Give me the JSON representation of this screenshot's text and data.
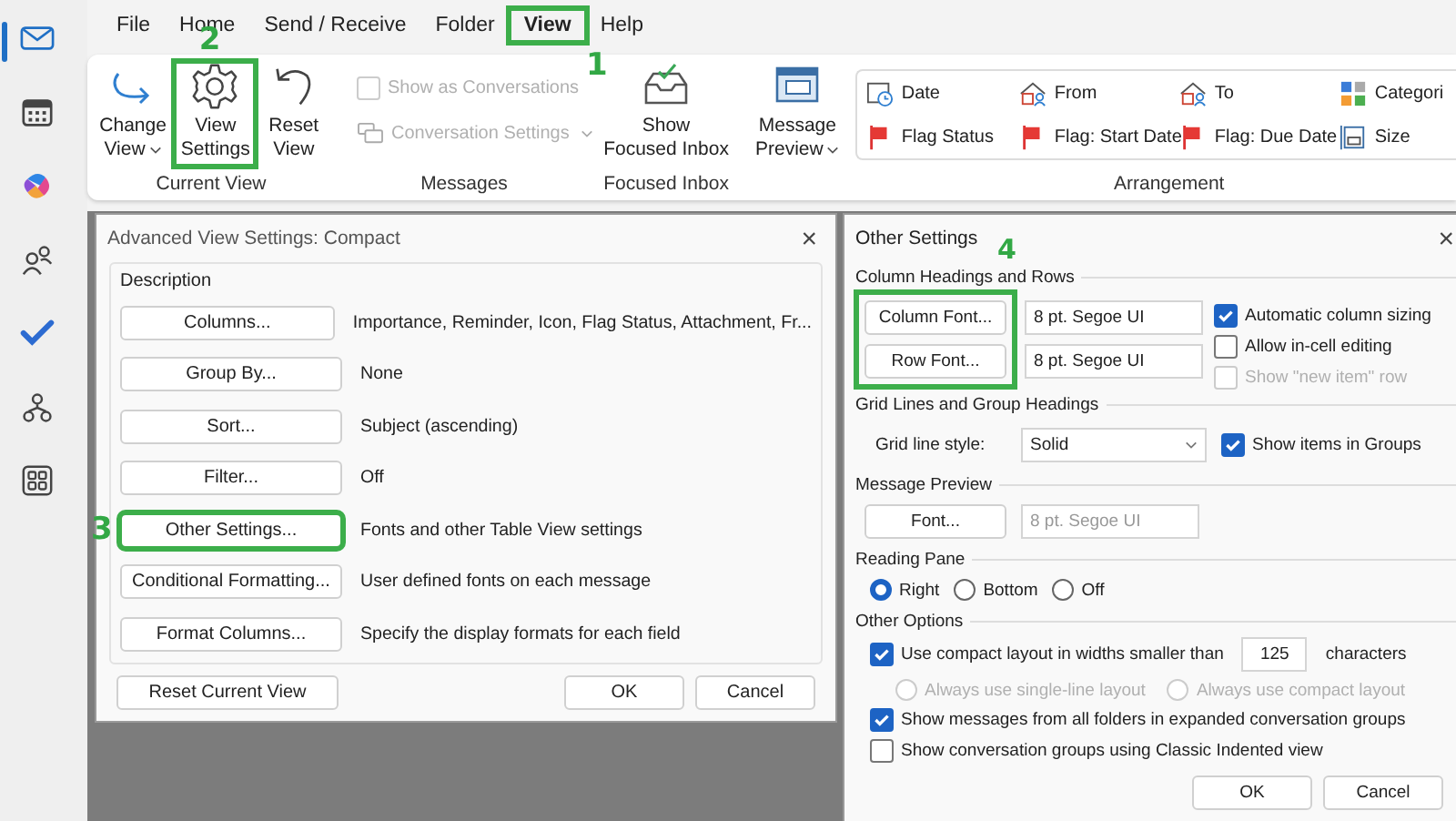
{
  "nav_rail": [
    {
      "kind": "mail",
      "selected": true
    },
    {
      "kind": "calendar",
      "selected": false
    },
    {
      "kind": "copilot",
      "selected": false
    },
    {
      "kind": "people",
      "selected": false
    },
    {
      "kind": "todo",
      "selected": false
    },
    {
      "kind": "org",
      "selected": false
    },
    {
      "kind": "apps",
      "selected": false
    }
  ],
  "menu_tabs": [
    {
      "label": "File",
      "selected": false,
      "highlight": false
    },
    {
      "label": "Home",
      "selected": false,
      "highlight": false
    },
    {
      "label": "Send / Receive",
      "selected": false,
      "highlight": false
    },
    {
      "label": "Folder",
      "selected": false,
      "highlight": false
    },
    {
      "label": "View",
      "selected": true,
      "highlight": true,
      "callout": "1"
    },
    {
      "label": "Help",
      "selected": false,
      "highlight": false
    }
  ],
  "ribbon": {
    "current_view": {
      "label": "Current View",
      "buttons": [
        {
          "kind": "change",
          "lines": [
            "Change",
            "View"
          ],
          "dropdown": true,
          "highlight": false
        },
        {
          "kind": "settings",
          "lines": [
            "View",
            "Settings"
          ],
          "dropdown": false,
          "highlight": true,
          "callout": "2"
        },
        {
          "kind": "reset",
          "lines": [
            "Reset",
            "View"
          ],
          "dropdown": false,
          "highlight": false
        }
      ]
    },
    "messages": {
      "label": "Messages",
      "checkbox": {
        "label": "Show as Conversations",
        "checked": false,
        "disabled": true
      },
      "settings": {
        "label": "Conversation Settings",
        "disabled": true
      }
    },
    "focused": {
      "label": "Focused Inbox",
      "lines": [
        "Show",
        "Focused Inbox"
      ]
    },
    "preview": {
      "lines": [
        "Message",
        "Preview"
      ]
    },
    "arrangement": {
      "label": "Arrangement",
      "items": [
        {
          "kind": "calendar",
          "label": "Date"
        },
        {
          "kind": "contact",
          "label": "From"
        },
        {
          "kind": "contact",
          "label": "To"
        },
        {
          "kind": "categories",
          "label": "Categori"
        },
        {
          "kind": "flag",
          "label": "Flag Status"
        },
        {
          "kind": "flag",
          "label": "Flag: Start Date"
        },
        {
          "kind": "flag",
          "label": "Flag: Due Date"
        },
        {
          "kind": "size",
          "label": "Size"
        }
      ]
    }
  },
  "advanced_dialog": {
    "title": "Advanced View Settings: Compact",
    "close": "×",
    "group": "Description",
    "rows": [
      {
        "button": "Columns...",
        "value": "Importance, Reminder, Icon, Flag Status, Attachment, Fr...",
        "highlight": false
      },
      {
        "button": "Group By...",
        "value": "None",
        "highlight": false
      },
      {
        "button": "Sort...",
        "value": "Subject (ascending)",
        "highlight": false
      },
      {
        "button": "Filter...",
        "value": "Off",
        "highlight": false
      },
      {
        "button": "Other Settings...",
        "value": "Fonts and other Table View settings",
        "highlight": true,
        "callout": "3"
      },
      {
        "button": "Conditional Formatting...",
        "value": "User defined fonts on each message",
        "highlight": false
      },
      {
        "button": "Format Columns...",
        "value": "Specify the display formats for each field",
        "highlight": false
      }
    ],
    "reset": "Reset Current View",
    "ok": "OK",
    "cancel": "Cancel"
  },
  "other_dialog": {
    "title": "Other Settings",
    "close": "×",
    "headings": {
      "title": "Column Headings and Rows",
      "highlight": true,
      "callout": "4",
      "fonts": [
        {
          "button": "Column Font...",
          "value": "8 pt. Segoe UI"
        },
        {
          "button": "Row Font...",
          "value": "8 pt. Segoe UI"
        }
      ],
      "options": [
        {
          "label": "Automatic column sizing",
          "checked": true,
          "disabled": false
        },
        {
          "label": "Allow in-cell editing",
          "checked": false,
          "disabled": false
        },
        {
          "label": "Show \"new item\" row",
          "checked": false,
          "disabled": true
        }
      ]
    },
    "grid": {
      "title": "Grid Lines and Group Headings",
      "style_label": "Grid line style:",
      "style_value": "Solid",
      "groups": {
        "label": "Show items in Groups",
        "checked": true,
        "disabled": false
      }
    },
    "preview": {
      "title": "Message Preview",
      "button": "Font...",
      "value": "8 pt. Segoe UI",
      "disabled": true
    },
    "reading_pane": {
      "title": "Reading Pane",
      "options": [
        {
          "label": "Right",
          "selected": true
        },
        {
          "label": "Bottom",
          "selected": false
        },
        {
          "label": "Off",
          "selected": false
        }
      ]
    },
    "other": {
      "title": "Other Options",
      "compact": {
        "label": "Use compact layout in widths smaller than",
        "checked": true,
        "disabled": false,
        "value": "125",
        "suffix": "characters"
      },
      "layouts": [
        {
          "label": "Always use single-line layout",
          "selected": false,
          "disabled": true
        },
        {
          "label": "Always use compact layout",
          "selected": false,
          "disabled": true
        }
      ],
      "options": [
        {
          "label": "Show messages from all folders in expanded conversation groups",
          "checked": true,
          "disabled": false
        },
        {
          "label": "Show conversation groups using Classic Indented view",
          "checked": false,
          "disabled": false
        }
      ]
    },
    "ok": "OK",
    "cancel": "Cancel"
  }
}
